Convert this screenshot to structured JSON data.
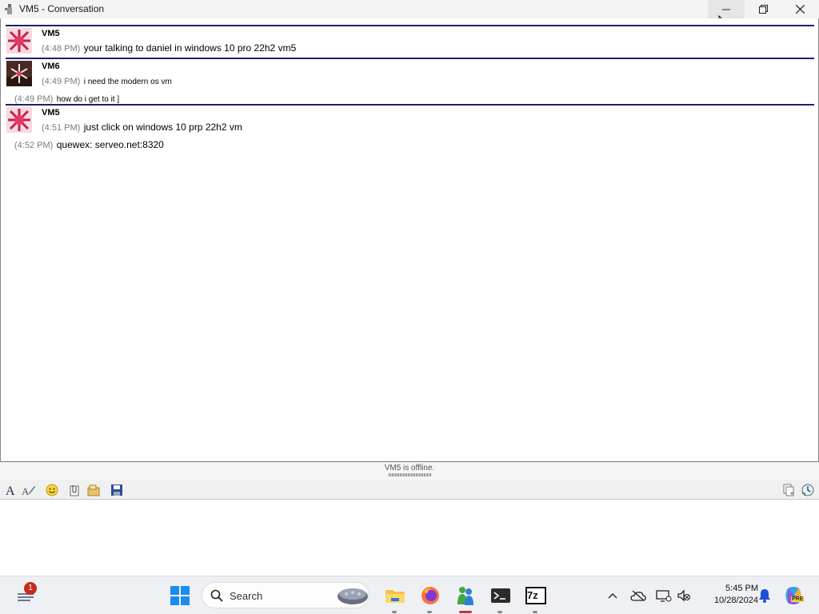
{
  "window": {
    "title": "VM5 - Conversation"
  },
  "conversation": {
    "groups": [
      {
        "sender": "VM5",
        "lines": [
          {
            "time": "(4:48 PM)",
            "text": "your talking to daniel in windows 10 pro 22h2 vm5"
          }
        ]
      },
      {
        "sender": "VM6",
        "lines": [
          {
            "time": "(4:49 PM)",
            "text": "i need the modern os vm"
          },
          {
            "time": "(4:49 PM)",
            "text": "how do i get to it ]"
          }
        ]
      },
      {
        "sender": "VM5",
        "lines": [
          {
            "time": "(4:51 PM)",
            "text": "just click on windows 10 prp 22h2 vm"
          },
          {
            "time": "(4:52 PM)",
            "text": "quewex: serveo.net:8320"
          }
        ]
      }
    ]
  },
  "status": {
    "text": "VM5 is offline."
  },
  "toolbar": {
    "left_icons": [
      "font-icon",
      "text-style-icon",
      "emoticon-icon",
      "send-file-icon",
      "nudge-icon",
      "save-icon"
    ],
    "right_icons": [
      "copy-icon",
      "history-icon"
    ]
  },
  "input": {
    "value": ""
  },
  "taskbar": {
    "widget_badge": "1",
    "search_label": "Search",
    "clock_time": "5:45 PM",
    "clock_date": "10/28/2024",
    "pinned": [
      "file-explorer-icon",
      "firefox-icon",
      "messenger-icon",
      "terminal-icon",
      "7zip-icon"
    ],
    "seven_zip_label": "7z",
    "copilot_label": "PRE"
  }
}
